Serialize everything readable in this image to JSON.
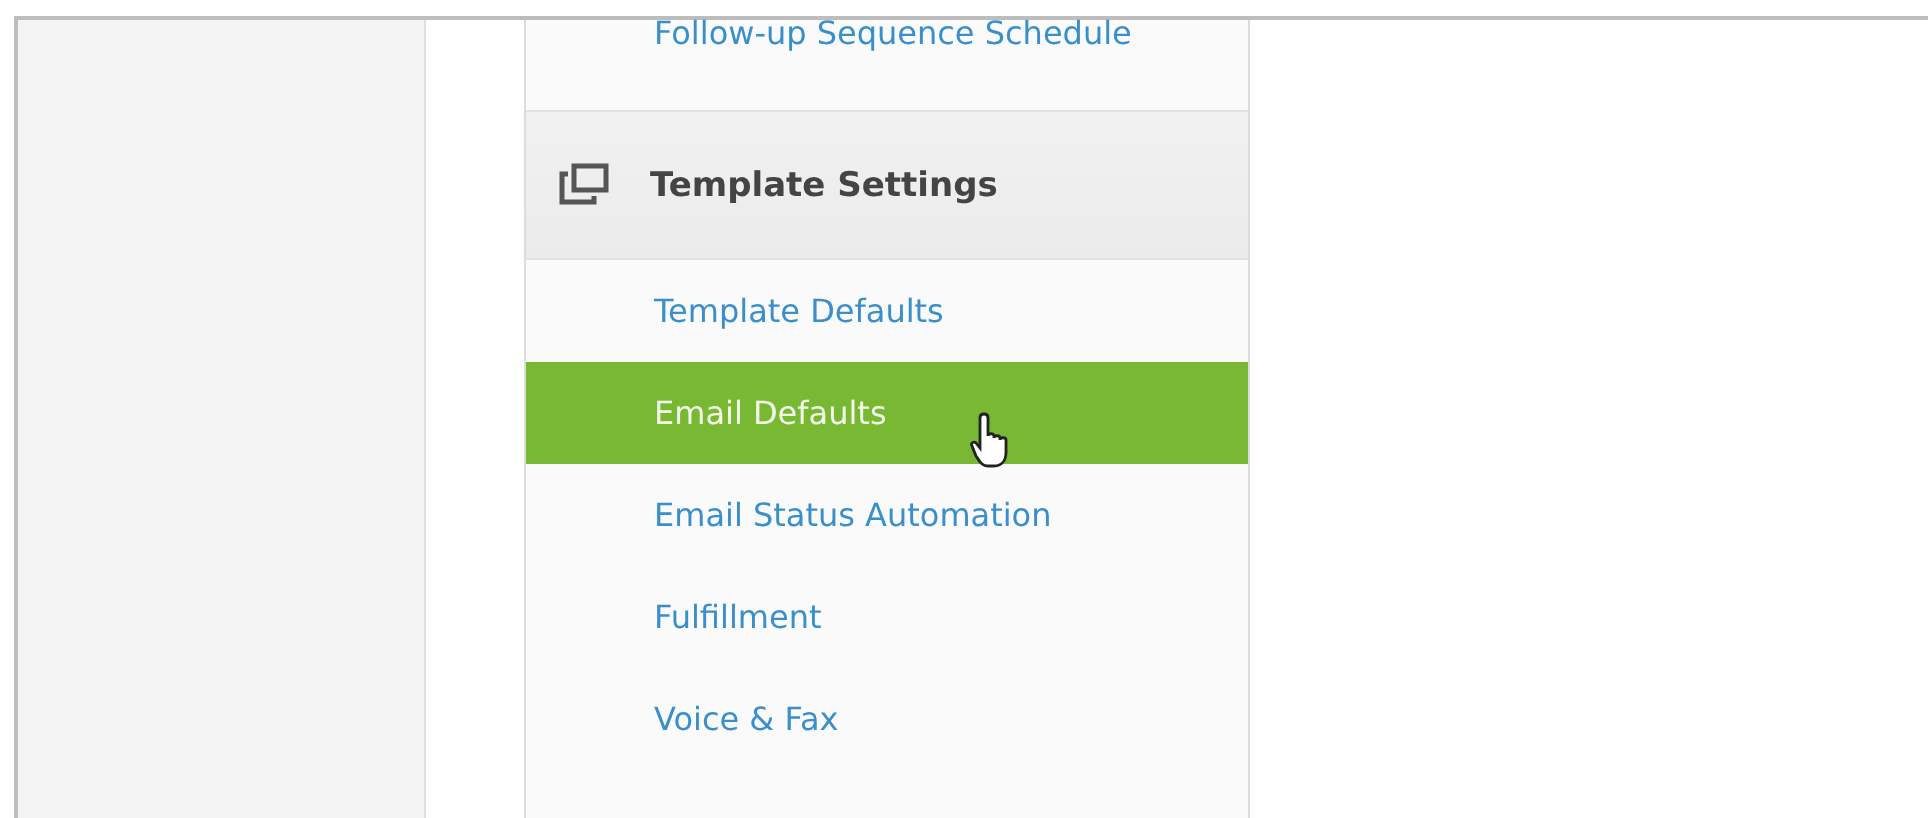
{
  "menu": {
    "top_item": {
      "label": "Follow-up Sequence Schedule",
      "selected": false
    },
    "section": {
      "title": "Template Settings"
    },
    "items": [
      {
        "label": "Template Defaults",
        "selected": false
      },
      {
        "label": "Email Defaults",
        "selected": true
      },
      {
        "label": "Email Status Automation",
        "selected": false
      },
      {
        "label": "Fulfillment",
        "selected": false
      },
      {
        "label": "Voice & Fax",
        "selected": false
      }
    ]
  }
}
